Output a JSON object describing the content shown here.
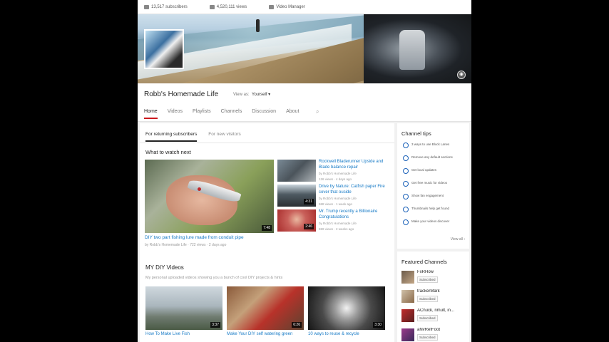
{
  "stats": {
    "subscribers": "13,517 subscribers",
    "views": "4,520,111 views",
    "video_manager": "Video Manager"
  },
  "channel": {
    "title": "Robb's Homemade Life",
    "view_as_label": "View as:",
    "view_as_value": "Yourself ▾"
  },
  "tabs": [
    "Home",
    "Videos",
    "Playlists",
    "Channels",
    "Discussion",
    "About"
  ],
  "subtabs": [
    "For returning subscribers",
    "For new visitors"
  ],
  "what_to_watch": {
    "heading": "What to watch next",
    "featured": {
      "title": "DIY two part fishing lure made from conduit pipe",
      "meta": "by Robb's Homemade Life · 722 views · 2 days ago",
      "duration": "7:48"
    },
    "side_videos": [
      {
        "title": "Rockwell Bladerunner Upside and Blade balance repair",
        "by": "by Robb's Homemade Life",
        "meta": "126 views · 4 days ago",
        "duration": ""
      },
      {
        "title": "Drive by Nature: Catfish paper Fire cover that ouside",
        "by": "by Robb's Homemade Life",
        "meta": "588 views · 1 week ago",
        "duration": "4:31"
      },
      {
        "title": "Mr. Trump recently a Billionaire Congratulations",
        "by": "by Robb's Homemade Life",
        "meta": "559 views · 2 weeks ago",
        "duration": "2:46"
      }
    ]
  },
  "playlist": {
    "title": "MY DIY Videos",
    "description": "My personal uploaded videos showing you a bunch of cool DIY projects & hints",
    "videos": [
      {
        "title": "How To Make Live Fish",
        "duration": "3:37"
      },
      {
        "title": "Make Your DIY self watering green",
        "duration": "6:26"
      },
      {
        "title": "10 ways to reuse & recycle",
        "duration": "3:30"
      }
    ]
  },
  "channel_tips": {
    "title": "Channel tips",
    "items": [
      "3 ways to use Block Lanes",
      "Remove any default sections",
      "Get local updates",
      "Get free music for videos",
      "Show fan engagement",
      "Thumbnails help get found",
      "Make your videos discover"
    ],
    "view_all": "View all ›"
  },
  "featured_channels": {
    "title": "Featured Channels",
    "subscribed_label": "Subscribed",
    "items": [
      {
        "name": "FxRHow"
      },
      {
        "name": "trackerMark"
      },
      {
        "name": "AChuck, nmult, in..."
      },
      {
        "name": "aNvRefFoot"
      }
    ]
  },
  "colors": {
    "link_blue": "#167ac6",
    "tab_red": "#cc181e",
    "tip_blue": "#1c62b9"
  }
}
